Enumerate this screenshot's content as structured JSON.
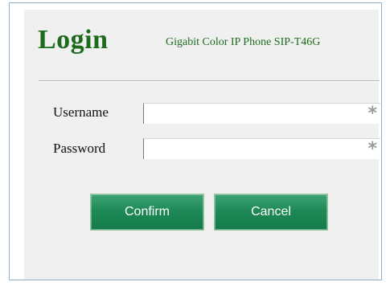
{
  "login": {
    "title": "Login",
    "model": "Gigabit Color IP Phone SIP-T46G",
    "username_label": "Username",
    "password_label": "Password",
    "username_value": "",
    "password_value": "",
    "required_mark": "*",
    "confirm_label": "Confirm",
    "cancel_label": "Cancel"
  },
  "colors": {
    "title_green": "#1e6b1e",
    "button_green": "#1f8a57",
    "frame_border": "#8eb0d6",
    "panel_bg": "#f0f0f0"
  }
}
